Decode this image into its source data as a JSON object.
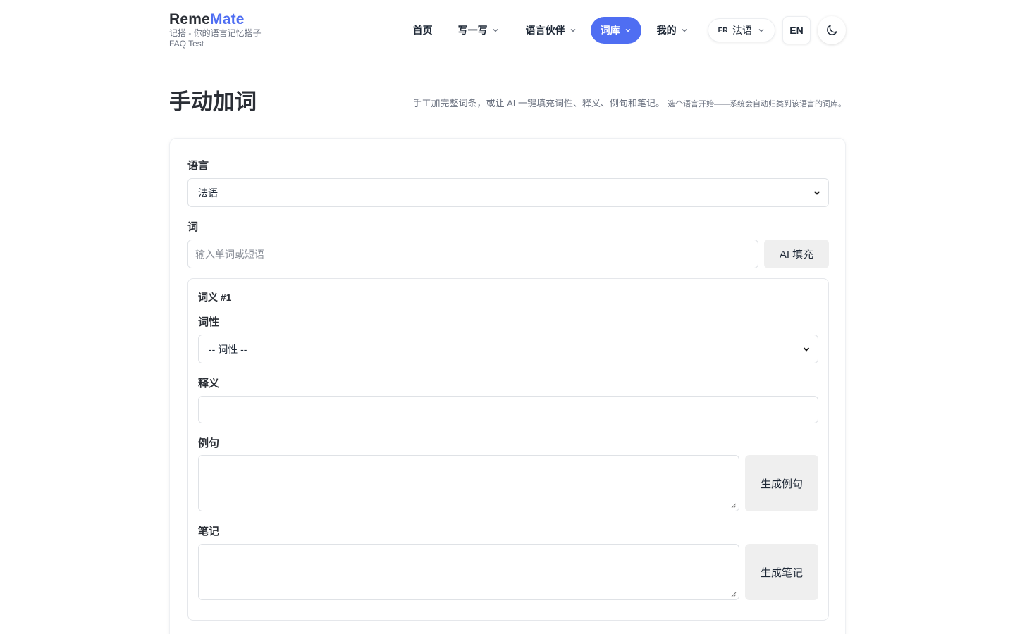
{
  "brand": {
    "name_a": "Reme",
    "name_b": "Mate",
    "tagline": "记搭 - 你的语言记忆搭子",
    "user": "FAQ Test"
  },
  "nav": {
    "home": "首页",
    "write": "写一写",
    "partners": "语言伙伴",
    "vocab": "词库",
    "mine": "我的",
    "lang_code": "FR",
    "lang_name": "法语",
    "ui_lang": "EN"
  },
  "page": {
    "title": "手动加词",
    "desc": "手工加完整词条，或让 AI 一键填充词性、释义、例句和笔记。",
    "desc_small": "选个语言开始——系统会自动归类到该语言的词库。"
  },
  "form": {
    "language_label": "语言",
    "language_value": "法语",
    "word_label": "词",
    "word_placeholder": "输入单词或短语",
    "ai_fill": "AI 填充",
    "sense_title": "词义 #1",
    "pos_label": "词性",
    "pos_value": "-- 词性 --",
    "def_label": "释义",
    "example_label": "例句",
    "gen_example": "生成例句",
    "note_label": "笔记",
    "gen_note": "生成笔记"
  },
  "colors": {
    "accent": "#4f6ef2",
    "text": "#1f2937",
    "muted": "#6b7280"
  },
  "icons": {
    "chevron": "chevron-down-icon",
    "theme": "moon-icon"
  }
}
